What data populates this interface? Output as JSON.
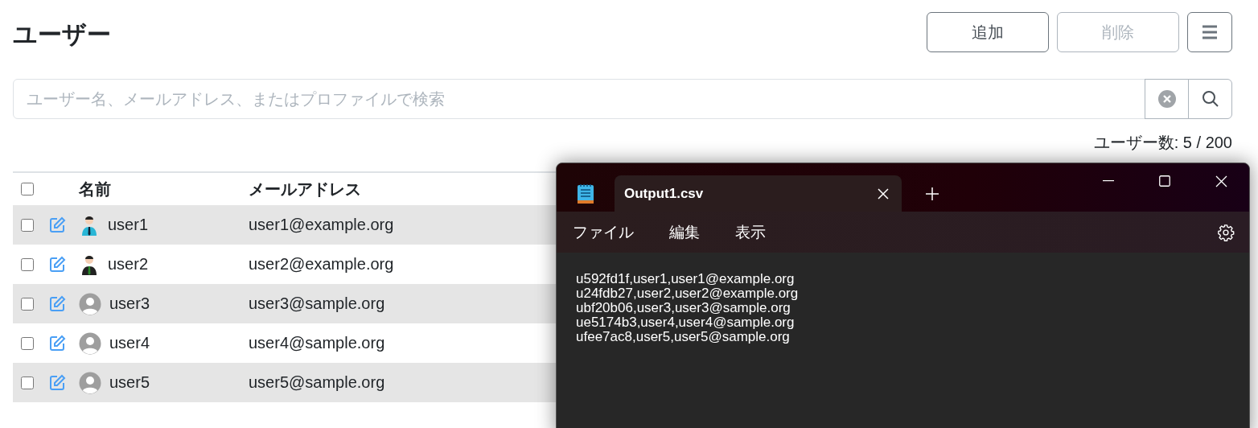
{
  "page": {
    "title": "ユーザー",
    "buttons": [
      {
        "label": "追加",
        "disabled": false
      },
      {
        "label": "削除",
        "disabled": true
      }
    ]
  },
  "search": {
    "placeholder": "ユーザー名、メールアドレス、またはプロファイルで検索"
  },
  "count": "ユーザー数: 5 / 200",
  "table": {
    "select_all": {
      "checked": false
    },
    "columns": [
      "名前",
      "メールアドレス"
    ],
    "rows": [
      {
        "checked": false,
        "kind": "blue-shirt",
        "name": "user1",
        "email": "user1@example.org"
      },
      {
        "checked": false,
        "kind": "dark-suit",
        "name": "user2",
        "email": "user2@example.org"
      },
      {
        "checked": false,
        "kind": "placeholder",
        "name": "user3",
        "email": "user3@sample.org"
      },
      {
        "checked": false,
        "kind": "placeholder",
        "name": "user4",
        "email": "user4@sample.org"
      },
      {
        "checked": false,
        "kind": "placeholder",
        "name": "user5",
        "email": "user5@sample.org"
      }
    ]
  },
  "notepad": {
    "tab": "Output1.csv",
    "menu": [
      "ファイル",
      "編集",
      "表示"
    ],
    "lines": [
      "u592fd1f,user1,user1@example.org",
      "u24fdb27,user2,user2@example.org",
      "ubf20b06,user3,user3@sample.org",
      "ue5174b3,user4,user4@sample.org",
      "ufee7ac8,user5,user5@sample.org"
    ]
  }
}
